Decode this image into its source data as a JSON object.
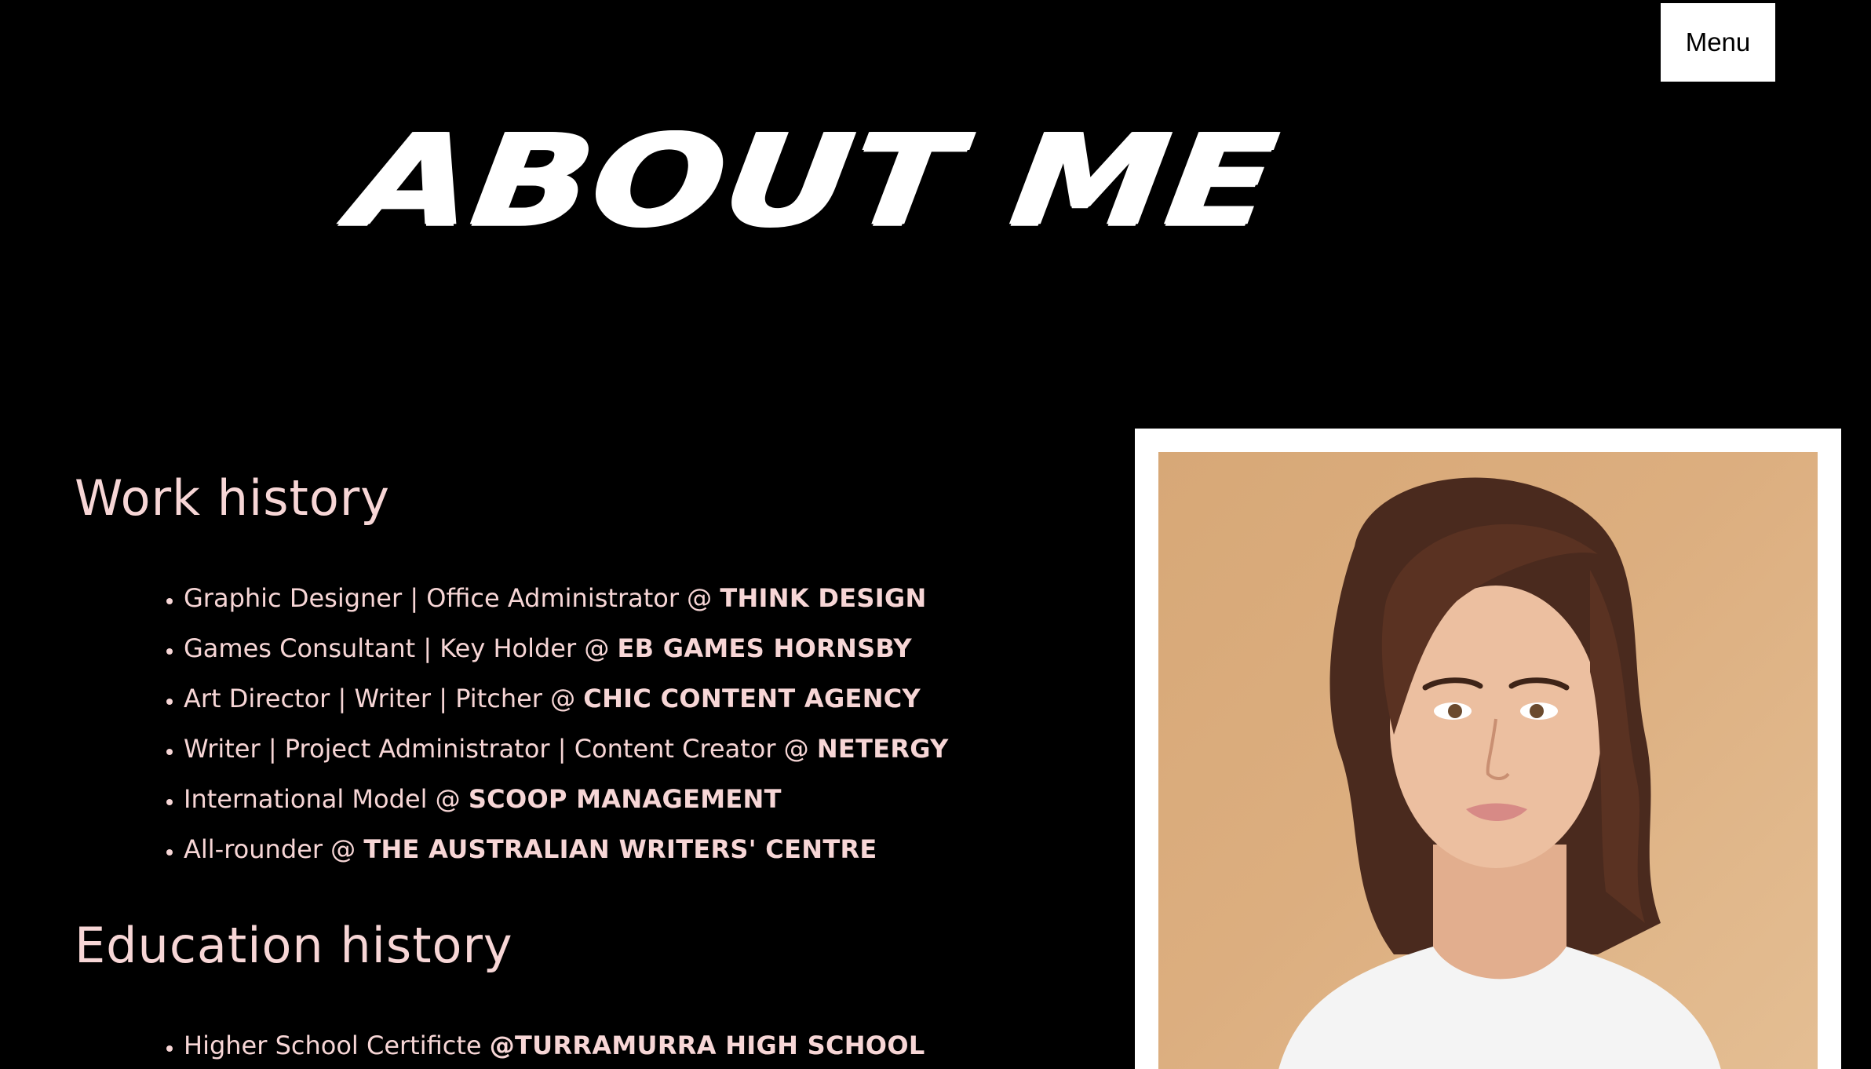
{
  "nav": {
    "menu_label": "Menu"
  },
  "page": {
    "title": "About me"
  },
  "work": {
    "heading": "Work history",
    "items": [
      {
        "role": "Graphic Designer | Office Administrator @ ",
        "company": "THINK DESIGN"
      },
      {
        "role": "Games Consultant | Key Holder @ ",
        "company": "EB GAMES HORNSBY"
      },
      {
        "role": "Art Director | Writer | Pitcher @ ",
        "company": "CHIC CONTENT AGENCY"
      },
      {
        "role": "Writer | Project Administrator | Content Creator @ ",
        "company": "NETERGY"
      },
      {
        "role": "International Model @ ",
        "company": "SCOOP MANAGEMENT"
      },
      {
        "role": "All-rounder @ ",
        "company": "THE AUSTRALIAN WRITERS' CENTRE"
      }
    ]
  },
  "education": {
    "heading": "Education history",
    "items": [
      {
        "role": "Higher School Certificte ",
        "company": "@TURRAMURRA HIGH SCHOOL"
      }
    ]
  },
  "colors": {
    "background": "#000000",
    "accent_text": "#f7d6d6",
    "title": "#ffffff",
    "photo_background": "#d9ab7b"
  }
}
